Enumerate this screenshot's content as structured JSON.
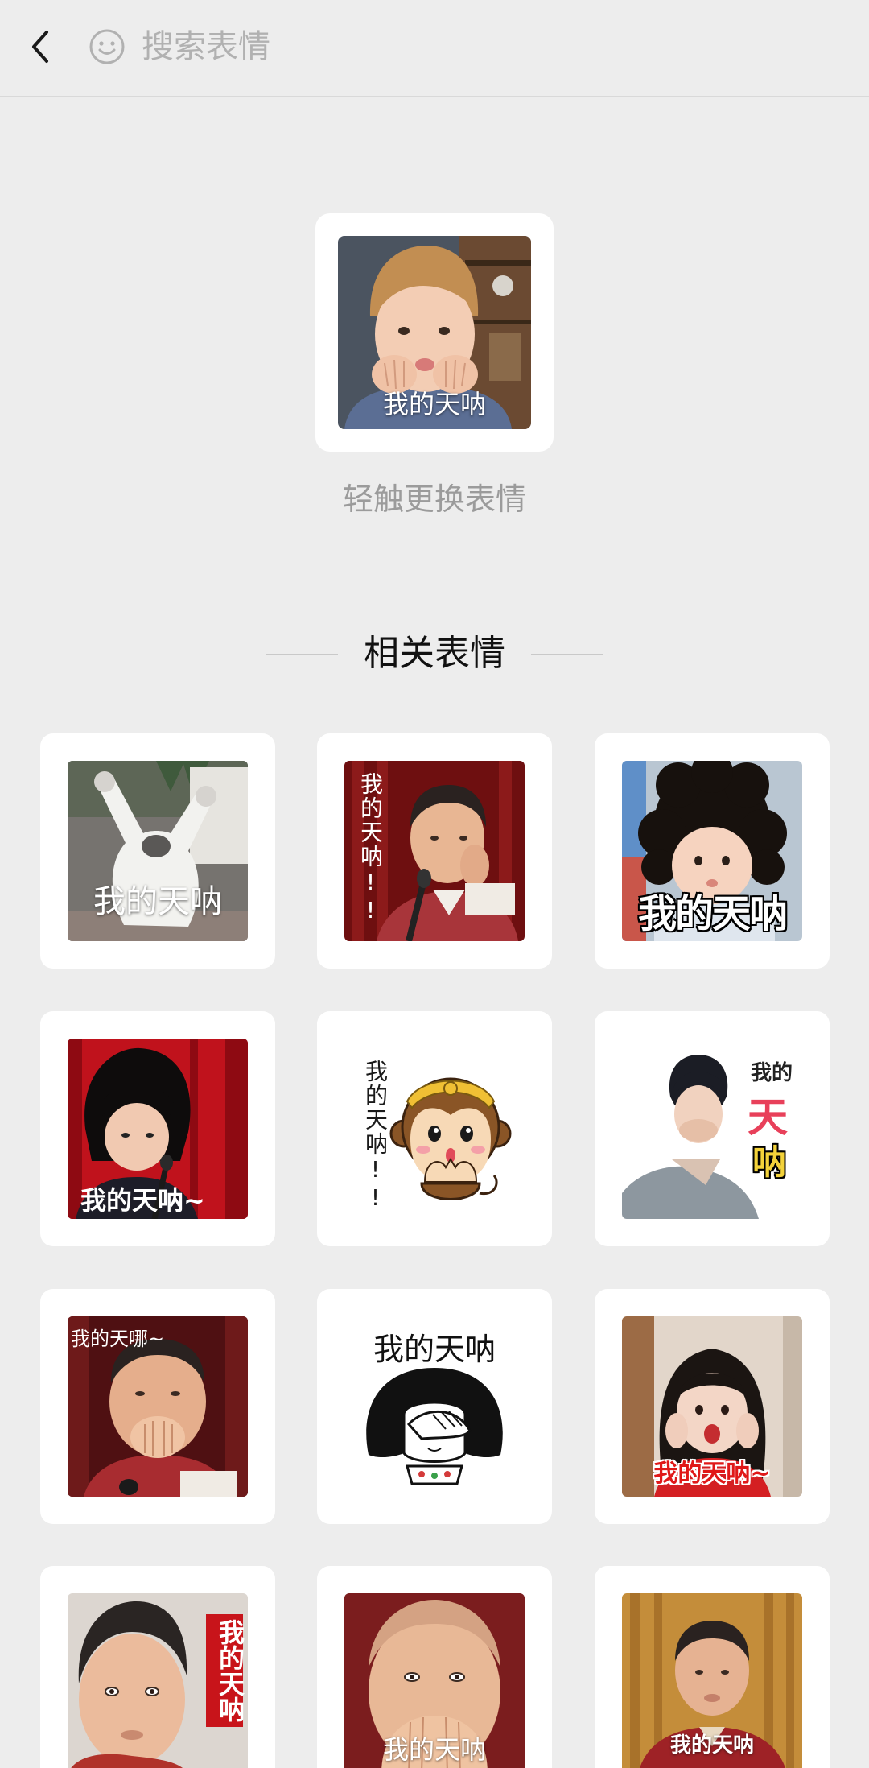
{
  "colors": {
    "background": "#ededed",
    "card": "#ffffff",
    "hint_text": "#9b9b9b",
    "title_text": "#111111",
    "placeholder_text": "#b1b1b1"
  },
  "header": {
    "back_icon": "chevron-left-icon",
    "emoji_icon": "smiley-icon",
    "search_placeholder": "搜索表情"
  },
  "featured": {
    "caption": "我的天呐",
    "hint": "轻触更换表情"
  },
  "related": {
    "title": "相关表情",
    "stickers": [
      {
        "caption": "我的天呐"
      },
      {
        "caption": "我的天呐!!"
      },
      {
        "caption": "我的天呐"
      },
      {
        "caption": "我的天呐~"
      },
      {
        "caption": "我的天呐!!"
      },
      {
        "caption_lines": [
          "我的",
          "天",
          "呐"
        ]
      },
      {
        "caption": "我的天哪~"
      },
      {
        "caption": "我的天呐"
      },
      {
        "caption": "我的天呐~"
      },
      {
        "caption": "我的天呐"
      },
      {
        "caption": "我的天呐"
      },
      {
        "caption": "我的天呐"
      }
    ]
  }
}
